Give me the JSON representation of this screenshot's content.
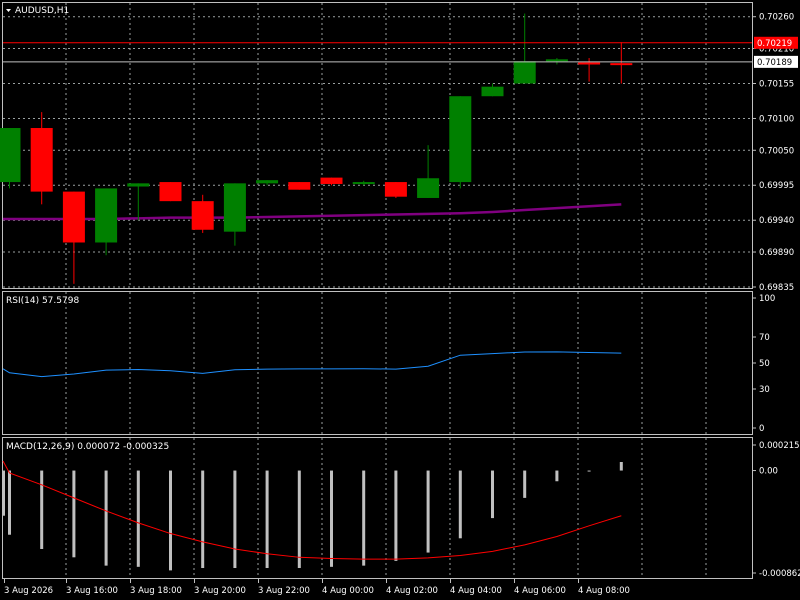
{
  "chart_title": "AUDUSD,H1",
  "price_axis": {
    "ticks": [
      "0.70260",
      "0.70210",
      "0.70155",
      "0.70100",
      "0.70050",
      "0.69995",
      "0.69940",
      "0.69890",
      "0.69835"
    ],
    "ask_label": "0.70219",
    "bid_label": "0.70189"
  },
  "rsi": {
    "label": "RSI(14) 57.5798",
    "ticks": [
      "100",
      "70",
      "50",
      "30",
      "0"
    ],
    "values": [
      45.5,
      42.5,
      39.5,
      41.5,
      44.5,
      45.0,
      44.0,
      42.0,
      44.8,
      45.3,
      45.5,
      45.5,
      45.6,
      45.3,
      47.5,
      56.0,
      57.2,
      58.5,
      58.6,
      58.1,
      57.6
    ]
  },
  "macd": {
    "label": "MACD(12,26,9) 0.000072 -0.000325",
    "ticks": [
      "0.000215",
      "0.00",
      "-0.000862"
    ],
    "histogram": [
      -0.00038,
      -0.00054,
      -0.00066,
      -0.00073,
      -0.0008,
      -0.00081,
      -0.00084,
      -0.00082,
      -0.00082,
      -0.00082,
      -0.00082,
      -0.00081,
      -0.0008,
      -0.00076,
      -0.00069,
      -0.00057,
      -0.0004,
      -0.00023,
      -9e-05,
      0.0,
      7.2e-05
    ],
    "signal": [
      8e-05,
      -2e-05,
      -0.00012,
      -0.00023,
      -0.00034,
      -0.00044,
      -0.00053,
      -0.0006,
      -0.00066,
      -0.0007,
      -0.00073,
      -0.00074,
      -0.000745,
      -0.000745,
      -0.000735,
      -0.000715,
      -0.00068,
      -0.000625,
      -0.000555,
      -0.000465,
      -0.00038
    ]
  },
  "time_axis": [
    "3 Aug 2026",
    "3 Aug 16:00",
    "3 Aug 18:00",
    "3 Aug 20:00",
    "3 Aug 22:00",
    "4 Aug 00:00",
    "4 Aug 02:00",
    "4 Aug 04:00",
    "4 Aug 06:00",
    "4 Aug 08:00"
  ],
  "colors": {
    "bull": "#008000",
    "bear": "#ff0000",
    "ma": "#800080",
    "rsi": "#1e90ff",
    "macd_hist": "#c0c0c0",
    "macd_signal": "#ff0000",
    "grid": "#9aa0a0",
    "ask": "#ff0000",
    "bid": "#c0c0c0"
  },
  "chart_data": {
    "type": "candlestick",
    "title": "AUDUSD,H1",
    "ylim": [
      0.69835,
      0.7028
    ],
    "bid_price": 0.70189,
    "ask_price": 0.70219,
    "candles": [
      {
        "o": 0.7,
        "h": 0.70085,
        "l": 0.6999,
        "c": 0.70085
      },
      {
        "o": 0.70085,
        "h": 0.7011,
        "l": 0.69965,
        "c": 0.69985
      },
      {
        "o": 0.69985,
        "h": 0.69985,
        "l": 0.6984,
        "c": 0.69905
      },
      {
        "o": 0.69905,
        "h": 0.6999,
        "l": 0.69885,
        "c": 0.6999
      },
      {
        "o": 0.69993,
        "h": 0.69998,
        "l": 0.6994,
        "c": 0.69998
      },
      {
        "o": 0.7,
        "h": 0.7,
        "l": 0.6997,
        "c": 0.6997
      },
      {
        "o": 0.6997,
        "h": 0.6998,
        "l": 0.6992,
        "c": 0.69925
      },
      {
        "o": 0.69922,
        "h": 0.69998,
        "l": 0.699,
        "c": 0.69998
      },
      {
        "o": 0.69998,
        "h": 0.70003,
        "l": 0.69995,
        "c": 0.70003
      },
      {
        "o": 0.7,
        "h": 0.7,
        "l": 0.69988,
        "c": 0.69988
      },
      {
        "o": 0.70007,
        "h": 0.70007,
        "l": 0.69995,
        "c": 0.69997
      },
      {
        "o": 0.69998,
        "h": 0.70002,
        "l": 0.69995,
        "c": 0.7
      },
      {
        "o": 0.7,
        "h": 0.7,
        "l": 0.69975,
        "c": 0.69977
      },
      {
        "o": 0.69975,
        "h": 0.70058,
        "l": 0.69975,
        "c": 0.70006
      },
      {
        "o": 0.7,
        "h": 0.70135,
        "l": 0.6999,
        "c": 0.70135
      },
      {
        "o": 0.70135,
        "h": 0.70155,
        "l": 0.70135,
        "c": 0.7015
      },
      {
        "o": 0.70155,
        "h": 0.70265,
        "l": 0.70155,
        "c": 0.7019
      },
      {
        "o": 0.7019,
        "h": 0.70195,
        "l": 0.70185,
        "c": 0.70193
      },
      {
        "o": 0.70188,
        "h": 0.70195,
        "l": 0.70158,
        "c": 0.70185
      },
      {
        "o": 0.70187,
        "h": 0.7022,
        "l": 0.70155,
        "c": 0.70185
      }
    ],
    "ma": [
      0.69942,
      0.69942,
      0.69942,
      0.69942,
      0.69943,
      0.69944,
      0.69944,
      0.69944,
      0.69945,
      0.69946,
      0.69947,
      0.69948,
      0.69949,
      0.6995,
      0.69951,
      0.69953,
      0.69956,
      0.69959,
      0.69962,
      0.69965
    ]
  }
}
